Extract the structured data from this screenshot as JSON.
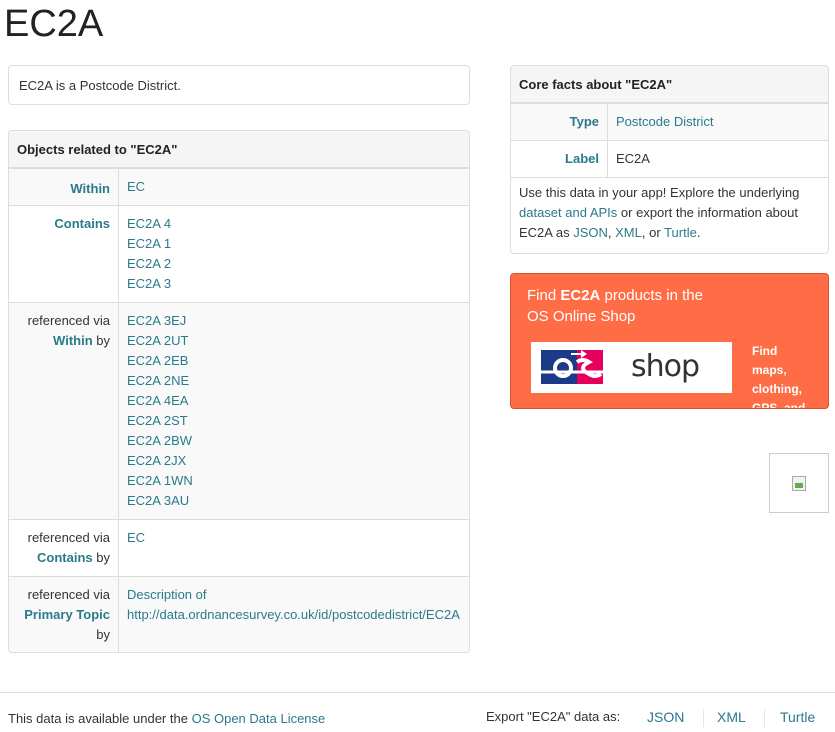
{
  "page": {
    "title": "EC2A"
  },
  "intro": {
    "text": "EC2A is a Postcode District."
  },
  "related": {
    "heading": "Objects related to \"EC2A\"",
    "within_label": "Within",
    "within_values": [
      "EC"
    ],
    "contains_label": "Contains",
    "contains_values": [
      "EC2A 4",
      "EC2A 1",
      "EC2A 2",
      "EC2A 3"
    ],
    "refvia_prefix": "referenced via",
    "by_suffix": "by",
    "ref_within_label": "Within",
    "ref_within_values": [
      "EC2A 3EJ",
      "EC2A 2UT",
      "EC2A 2EB",
      "EC2A 2NE",
      "EC2A 4EA",
      "EC2A 2ST",
      "EC2A 2BW",
      "EC2A 2JX",
      "EC2A 1WN",
      "EC2A 3AU"
    ],
    "ref_contains_label": "Contains",
    "ref_contains_values": [
      "EC"
    ],
    "ref_topic_label": "Primary Topic",
    "ref_topic_line1": "Description of",
    "ref_topic_line2": "http://data.ordnancesurvey.co.uk/id/postcodedistrict/EC2A"
  },
  "core": {
    "heading": "Core facts about \"EC2A\"",
    "type_label": "Type",
    "type_value": "Postcode District",
    "label_label": "Label",
    "label_value": "EC2A",
    "desc_a": "Use this data in your app! Explore the underlying",
    "desc_link_dataset": "dataset and APIs",
    "desc_b": "or export the information about",
    "desc_c": "EC2A as",
    "desc_json": "JSON",
    "desc_comma": ",",
    "desc_xml": "XML",
    "desc_or": ", or",
    "desc_turtle": "Turtle",
    "desc_end": "."
  },
  "shop": {
    "title_find": "Find",
    "title_code": "EC2A",
    "title_rest1": "products in the",
    "title_rest2": "OS Online Shop",
    "logo_os": "os",
    "logo_shop": "shop",
    "side_text_1": "Find",
    "side_text_2": "maps,",
    "side_text_3": "clothing,",
    "side_text_4": "GPS, and"
  },
  "footer": {
    "license_prefix": "This data is available under the",
    "license_link": "OS Open Data License",
    "export_label": "Export \"EC2A\" data as:",
    "export_json": "JSON",
    "export_xml": "XML",
    "export_turtle": "Turtle"
  },
  "colors": {
    "link": "#2a7a8c",
    "shop_bg": "#ff6d46",
    "os_blue": "#1d3a8a",
    "os_pink": "#e6005c"
  }
}
